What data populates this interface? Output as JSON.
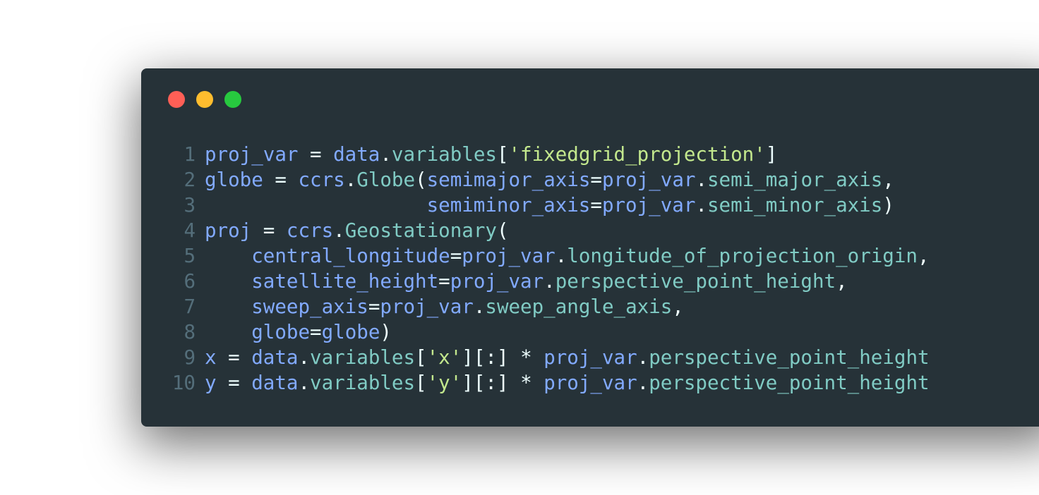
{
  "window": {
    "controls": [
      "close",
      "minimize",
      "maximize"
    ],
    "colors": {
      "background": "#263238",
      "close": "#ff5f56",
      "minimize": "#ffbd2e",
      "maximize": "#27c93f",
      "line_number": "#546e7a",
      "variable": "#82aaff",
      "attribute": "#80cbc4",
      "string": "#c3e88d",
      "text": "#eeffff"
    }
  },
  "code": {
    "lines": [
      {
        "number": "1",
        "tokens": [
          {
            "t": "proj_var",
            "k": "var"
          },
          {
            "t": " = ",
            "k": "op"
          },
          {
            "t": "data",
            "k": "var"
          },
          {
            "t": ".",
            "k": "punct"
          },
          {
            "t": "variables",
            "k": "attr"
          },
          {
            "t": "[",
            "k": "punct"
          },
          {
            "t": "'fixedgrid_projection'",
            "k": "str"
          },
          {
            "t": "]",
            "k": "punct"
          }
        ]
      },
      {
        "number": "2",
        "tokens": [
          {
            "t": "globe",
            "k": "var"
          },
          {
            "t": " = ",
            "k": "op"
          },
          {
            "t": "ccrs",
            "k": "var"
          },
          {
            "t": ".",
            "k": "punct"
          },
          {
            "t": "Globe",
            "k": "attr"
          },
          {
            "t": "(",
            "k": "punct"
          },
          {
            "t": "semimajor_axis",
            "k": "var"
          },
          {
            "t": "=",
            "k": "op"
          },
          {
            "t": "proj_var",
            "k": "var"
          },
          {
            "t": ".",
            "k": "punct"
          },
          {
            "t": "semi_major_axis",
            "k": "attr"
          },
          {
            "t": ",",
            "k": "punct"
          }
        ]
      },
      {
        "number": "3",
        "tokens": [
          {
            "t": "                   ",
            "k": "punct"
          },
          {
            "t": "semiminor_axis",
            "k": "var"
          },
          {
            "t": "=",
            "k": "op"
          },
          {
            "t": "proj_var",
            "k": "var"
          },
          {
            "t": ".",
            "k": "punct"
          },
          {
            "t": "semi_minor_axis",
            "k": "attr"
          },
          {
            "t": ")",
            "k": "punct"
          }
        ]
      },
      {
        "number": "4",
        "tokens": [
          {
            "t": "proj",
            "k": "var"
          },
          {
            "t": " = ",
            "k": "op"
          },
          {
            "t": "ccrs",
            "k": "var"
          },
          {
            "t": ".",
            "k": "punct"
          },
          {
            "t": "Geostationary",
            "k": "attr"
          },
          {
            "t": "(",
            "k": "punct"
          }
        ]
      },
      {
        "number": "5",
        "tokens": [
          {
            "t": "    ",
            "k": "punct"
          },
          {
            "t": "central_longitude",
            "k": "var"
          },
          {
            "t": "=",
            "k": "op"
          },
          {
            "t": "proj_var",
            "k": "var"
          },
          {
            "t": ".",
            "k": "punct"
          },
          {
            "t": "longitude_of_projection_origin",
            "k": "attr"
          },
          {
            "t": ",",
            "k": "punct"
          }
        ]
      },
      {
        "number": "6",
        "tokens": [
          {
            "t": "    ",
            "k": "punct"
          },
          {
            "t": "satellite_height",
            "k": "var"
          },
          {
            "t": "=",
            "k": "op"
          },
          {
            "t": "proj_var",
            "k": "var"
          },
          {
            "t": ".",
            "k": "punct"
          },
          {
            "t": "perspective_point_height",
            "k": "attr"
          },
          {
            "t": ",",
            "k": "punct"
          }
        ]
      },
      {
        "number": "7",
        "tokens": [
          {
            "t": "    ",
            "k": "punct"
          },
          {
            "t": "sweep_axis",
            "k": "var"
          },
          {
            "t": "=",
            "k": "op"
          },
          {
            "t": "proj_var",
            "k": "var"
          },
          {
            "t": ".",
            "k": "punct"
          },
          {
            "t": "sweep_angle_axis",
            "k": "attr"
          },
          {
            "t": ",",
            "k": "punct"
          }
        ]
      },
      {
        "number": "8",
        "tokens": [
          {
            "t": "    ",
            "k": "punct"
          },
          {
            "t": "globe",
            "k": "var"
          },
          {
            "t": "=",
            "k": "op"
          },
          {
            "t": "globe",
            "k": "var"
          },
          {
            "t": ")",
            "k": "punct"
          }
        ]
      },
      {
        "number": "9",
        "tokens": [
          {
            "t": "x",
            "k": "var"
          },
          {
            "t": " = ",
            "k": "op"
          },
          {
            "t": "data",
            "k": "var"
          },
          {
            "t": ".",
            "k": "punct"
          },
          {
            "t": "variables",
            "k": "attr"
          },
          {
            "t": "[",
            "k": "punct"
          },
          {
            "t": "'x'",
            "k": "str"
          },
          {
            "t": "][:] * ",
            "k": "punct"
          },
          {
            "t": "proj_var",
            "k": "var"
          },
          {
            "t": ".",
            "k": "punct"
          },
          {
            "t": "perspective_point_height",
            "k": "attr"
          }
        ]
      },
      {
        "number": "10",
        "tokens": [
          {
            "t": "y",
            "k": "var"
          },
          {
            "t": " = ",
            "k": "op"
          },
          {
            "t": "data",
            "k": "var"
          },
          {
            "t": ".",
            "k": "punct"
          },
          {
            "t": "variables",
            "k": "attr"
          },
          {
            "t": "[",
            "k": "punct"
          },
          {
            "t": "'y'",
            "k": "str"
          },
          {
            "t": "][:] * ",
            "k": "punct"
          },
          {
            "t": "proj_var",
            "k": "var"
          },
          {
            "t": ".",
            "k": "punct"
          },
          {
            "t": "perspective_point_height",
            "k": "attr"
          }
        ]
      }
    ]
  }
}
